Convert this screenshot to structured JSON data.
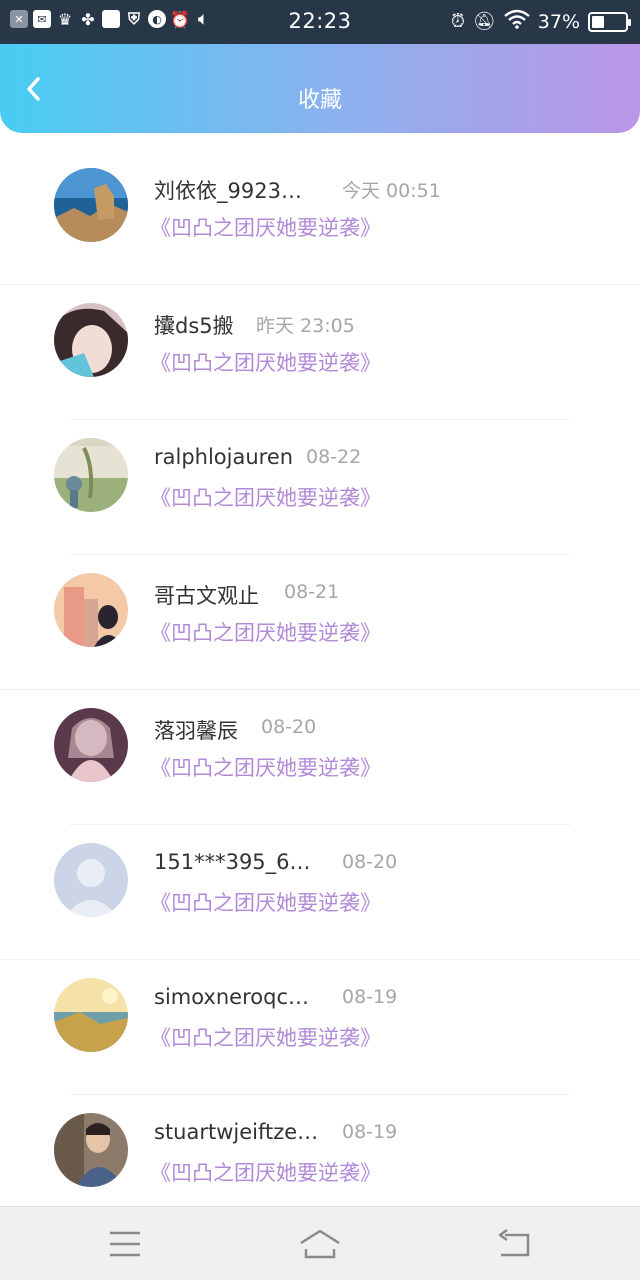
{
  "status_bar": {
    "time": "22:23",
    "battery": "37%",
    "battery_level": 0.37
  },
  "header": {
    "title": "收藏",
    "back_icon": "chevron-left-icon"
  },
  "favorites": [
    {
      "user": "刘依依_9923…",
      "time": "今天 00:51",
      "book": "《凹凸之团厌她要逆袭》"
    },
    {
      "user": "攮ds5搬",
      "time": "昨天 23:05",
      "book": "《凹凸之团厌她要逆袭》"
    },
    {
      "user": "ralphlojauren",
      "time": "08-22",
      "book": "《凹凸之团厌她要逆袭》"
    },
    {
      "user": "哥古文观止",
      "time": "08-21",
      "book": "《凹凸之团厌她要逆袭》"
    },
    {
      "user": "落羽馨辰",
      "time": "08-20",
      "book": "《凹凸之团厌她要逆袭》"
    },
    {
      "user": "151***395_6…",
      "time": "08-20",
      "book": "《凹凸之团厌她要逆袭》"
    },
    {
      "user": "simoxneroqc…",
      "time": "08-19",
      "book": "《凹凸之团厌她要逆袭》"
    },
    {
      "user": "stuartwjeiftze…",
      "time": "08-19",
      "book": "《凹凸之团厌她要逆袭》"
    }
  ],
  "nav_bar": {
    "items": [
      "menu-icon",
      "home-icon",
      "back-icon"
    ]
  },
  "colors": {
    "accent_purple": "#b28ad8",
    "header_start": "#48cdf2",
    "header_end": "#bb96e6",
    "status_bar_bg": "#283748"
  }
}
